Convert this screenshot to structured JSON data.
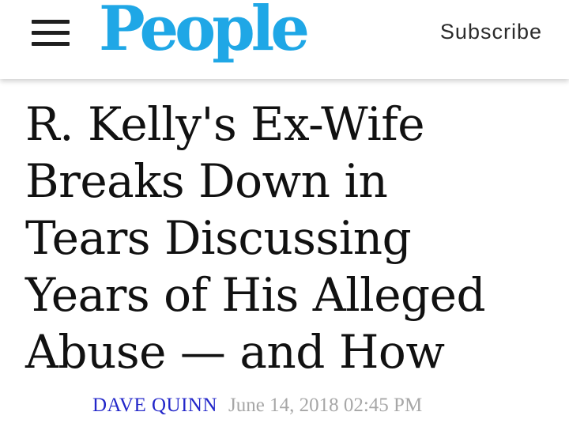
{
  "header": {
    "menu_icon": "hamburger-menu-icon",
    "logo_text": "People",
    "subscribe_label": "Subscribe"
  },
  "article": {
    "headline_lines": [
      "R. Kelly's Ex-Wife",
      "Breaks Down in",
      "Tears Discussing",
      "Years of His Alleged",
      "Abuse — and How"
    ],
    "author": "DAVE QUINN",
    "date": "June 14, 2018 02:45 PM"
  },
  "colors": {
    "brand": "#1fa7e6",
    "author": "#2327c9",
    "date": "#a7a7a7",
    "text": "#111111"
  }
}
